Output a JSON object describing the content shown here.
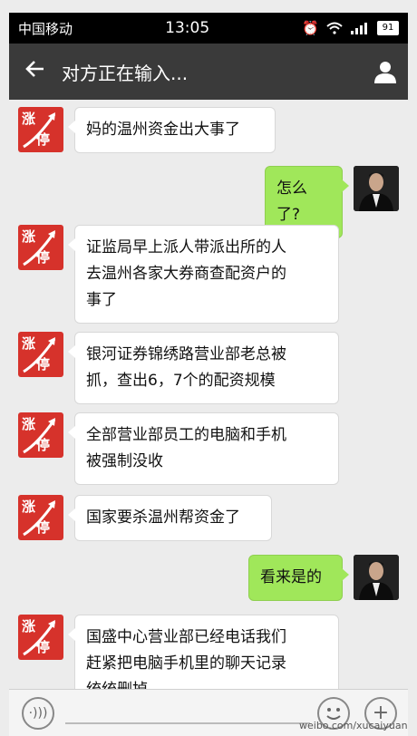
{
  "status_bar": {
    "carrier": "中国移动",
    "time": "13:05",
    "battery": "91"
  },
  "header": {
    "title": "对方正在输入..."
  },
  "messages": [
    {
      "side": "left",
      "text": "妈的温州资金出大事了"
    },
    {
      "side": "right",
      "text": "怎么了?"
    },
    {
      "side": "left",
      "text": "证监局早上派人带派出所的人\n去温州各家大券商查配资户的\n事了"
    },
    {
      "side": "left",
      "text": "银河证券锦绣路营业部老总被\n抓，查出6，7个的配资规模"
    },
    {
      "side": "left",
      "text": "全部营业部员工的电脑和手机\n被强制没收"
    },
    {
      "side": "left",
      "text": "国家要杀温州帮资金了"
    },
    {
      "side": "right",
      "text": "看来是的"
    },
    {
      "side": "left",
      "text": "国盛中心营业部已经电话我们\n赶紧把电脑手机里的聊天记录\n统统删掉"
    }
  ],
  "avatar_left": {
    "line1": "涨",
    "line2": "停"
  },
  "colors": {
    "header_bg": "#3a3a3a",
    "sent_bubble": "#a0e75a",
    "avatar_left_bg": "#d6322b"
  },
  "icons": {
    "back": "arrow-left-icon",
    "user": "user-icon",
    "voice": "voice-icon",
    "emoji": "emoji-icon",
    "plus": "plus-icon"
  },
  "watermark": "weibo.com/xucaiyuan"
}
